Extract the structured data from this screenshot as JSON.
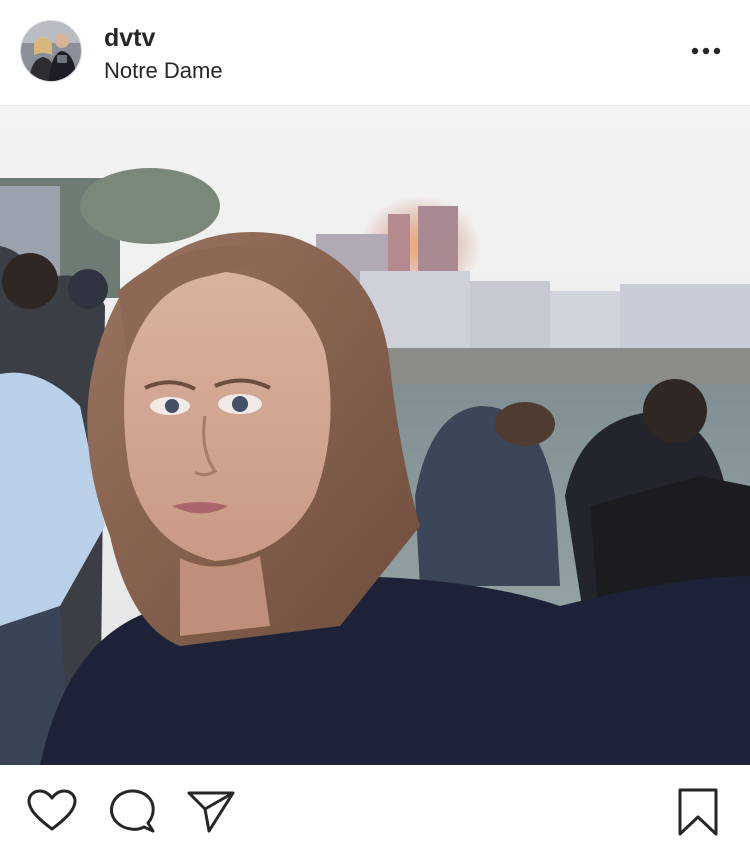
{
  "post": {
    "username": "dvtv",
    "location": "Notre Dame"
  },
  "icons": {
    "more": "more-options-icon",
    "like": "heart-icon",
    "comment": "comment-icon",
    "share": "paper-plane-icon",
    "save": "bookmark-icon"
  },
  "colors": {
    "text": "#262626",
    "divider": "#e6e6e6",
    "background": "#ffffff"
  }
}
